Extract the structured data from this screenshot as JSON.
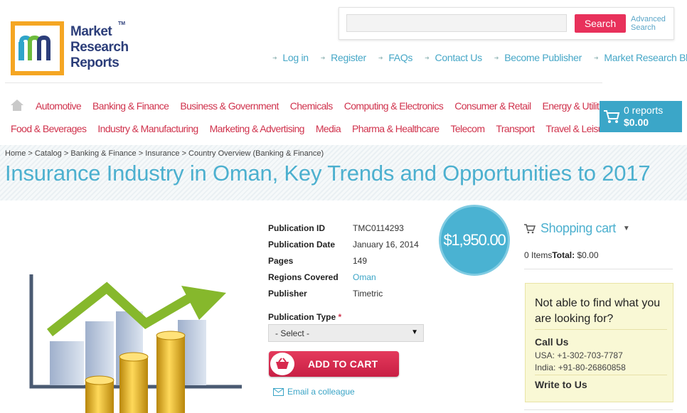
{
  "logo": {
    "lines": [
      "Market",
      "Research",
      "Reports"
    ],
    "tm": "TM",
    "letter": "m"
  },
  "search": {
    "placeholder": "",
    "button": "Search",
    "advanced": "Advanced Search"
  },
  "top_links": [
    "Log in",
    "Register",
    "FAQs",
    "Contact Us",
    "Become Publisher",
    "Market Research Blog"
  ],
  "categories_row1": [
    "Automotive",
    "Banking & Finance",
    "Business & Government",
    "Chemicals",
    "Computing & Electronics",
    "Consumer & Retail",
    "Energy & Utilities"
  ],
  "categories_row2": [
    "Food & Beverages",
    "Industry & Manufacturing",
    "Marketing & Advertising",
    "Media",
    "Pharma & Healthcare",
    "Telecom",
    "Transport",
    "Travel & Leisure"
  ],
  "cart": {
    "count": "0 reports",
    "total": "$0.00"
  },
  "breadcrumb": "Home > Catalog > Banking & Finance > Insurance > Country Overview (Banking & Finance)",
  "title": "Insurance Industry in Oman, Key Trends and Opportunities to 2017",
  "details": [
    {
      "label": "Publication ID",
      "value": "TMC0114293"
    },
    {
      "label": "Publication Date",
      "value": "January 16, 2014"
    },
    {
      "label": "Pages",
      "value": "149"
    },
    {
      "label": "Regions Covered",
      "value": "Oman"
    },
    {
      "label": "Publisher",
      "value": "Timetric"
    }
  ],
  "publication_type": {
    "label": "Publication Type",
    "required_mark": "*",
    "selected": "- Select -"
  },
  "add_to_cart": "ADD TO CART",
  "email_colleague": "Email a colleague",
  "price": "$1,950.00",
  "shopping_cart": {
    "heading": "Shopping cart",
    "items": "0 Items",
    "total_label": "Total:",
    "total": "$0.00"
  },
  "help": {
    "question": "Not able to find what you are looking for?",
    "call_heading": "Call Us",
    "usa": "USA: +1-302-703-7787",
    "india": "India: +91-80-26860858",
    "write_heading": "Write to Us"
  },
  "colors": {
    "accent_blue": "#4cb0cf",
    "accent_red": "#d0334d",
    "logo_orange": "#f5a623",
    "logo_navy": "#2c3e7a"
  }
}
